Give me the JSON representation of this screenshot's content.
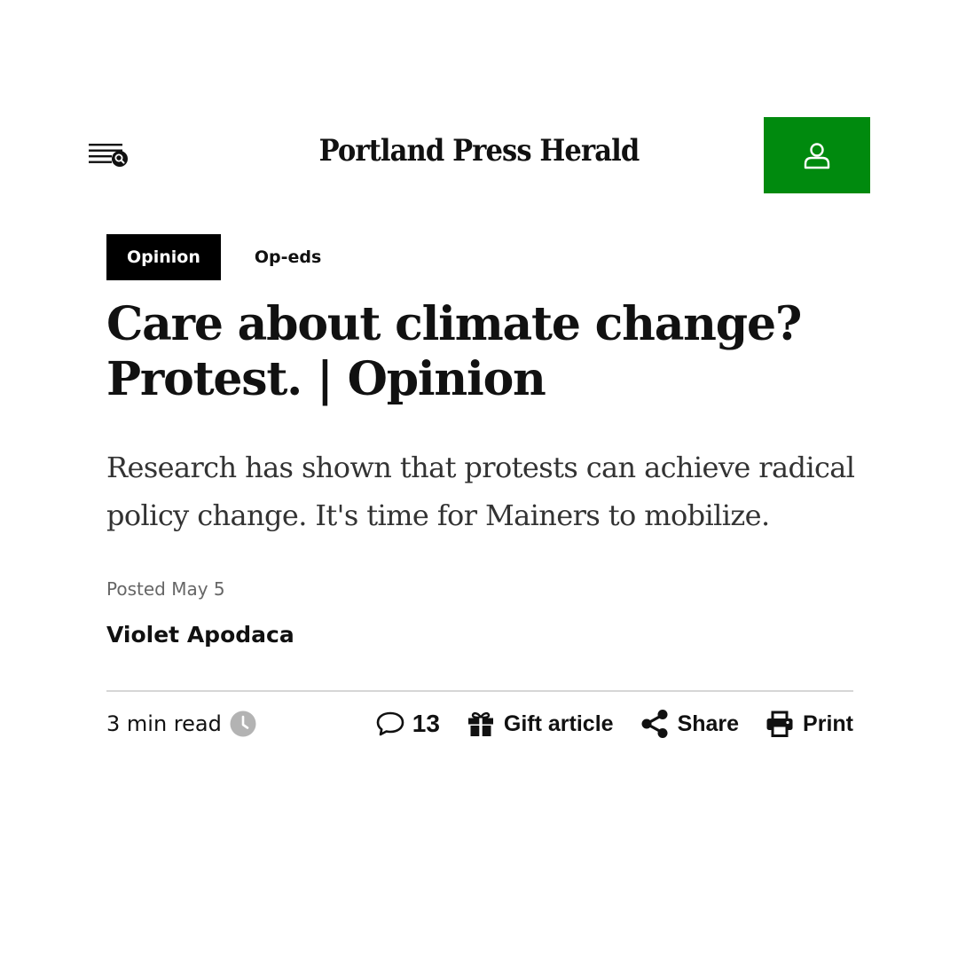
{
  "header": {
    "masthead": "Portland Press Herald",
    "menu_icon": "menu-search-icon",
    "account_icon": "user-icon",
    "accent_color": "#008a0e"
  },
  "section": {
    "primary": "Opinion",
    "secondary": "Op-eds"
  },
  "article": {
    "headline_line1": "Care about climate change?",
    "headline_line2": "Protest. | Opinion",
    "dek_line1": "Research has shown that protests can achieve radical",
    "dek_line2": "policy change. It's time for Mainers to mobilize.",
    "posted": "Posted May 5",
    "author": "Violet Apodaca"
  },
  "toolbar": {
    "read_time": "3 min read",
    "comment_count": "13",
    "gift_label": "Gift article",
    "share_label": "Share",
    "print_label": "Print"
  }
}
